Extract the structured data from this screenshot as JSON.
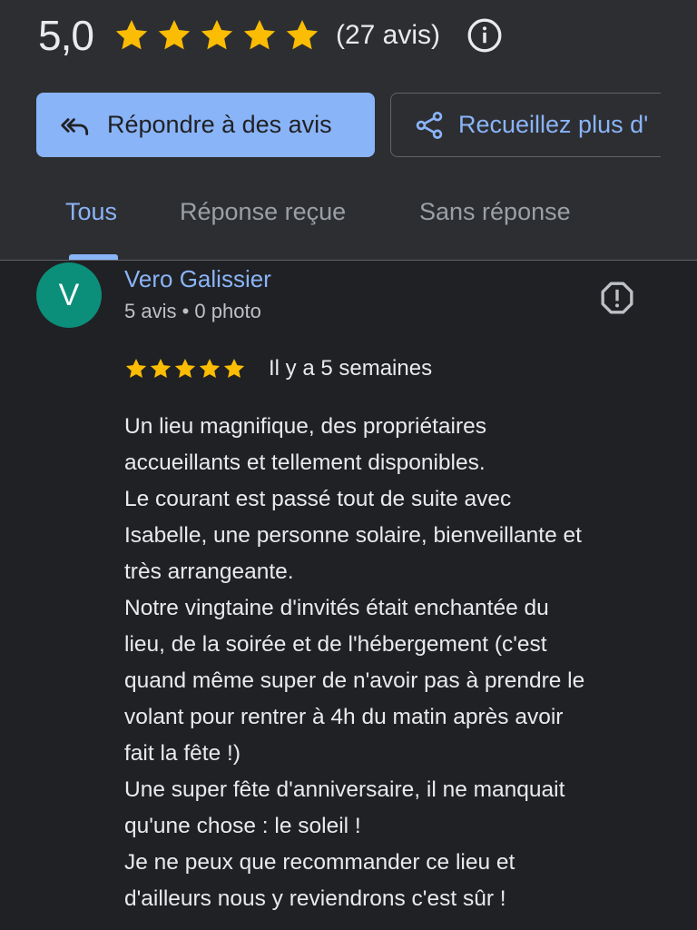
{
  "summary": {
    "score": "5,0",
    "star_count": 5,
    "star_color": "#fbbc04",
    "review_count": "(27 avis)",
    "info_icon": "info-icon"
  },
  "actions": {
    "reply_label": "Répondre à des avis",
    "reply_icon": "reply-all-icon",
    "collect_label": "Recueillez plus d'",
    "collect_icon": "share-icon"
  },
  "tabs": [
    {
      "label": "Tous",
      "active": true
    },
    {
      "label": "Réponse reçue",
      "active": false
    },
    {
      "label": "Sans réponse",
      "active": false
    }
  ],
  "review": {
    "avatar_letter": "V",
    "avatar_color": "#0b8e7a",
    "author": "Vero Galissier",
    "meta": "5 avis • 0 photo",
    "rating": 5,
    "date": "Il y a 5 semaines",
    "report_icon": "report-icon",
    "text_lines": [
      "Un lieu magnifique, des propriétaires",
      "accueillants et tellement disponibles.",
      "Le courant est passé tout de suite avec",
      "Isabelle, une personne solaire, bienveillante et",
      "très arrangeante.",
      "Notre vingtaine d'invités était enchantée du",
      "lieu, de la soirée et de l'hébergement (c'est",
      "quand même super de n'avoir pas à prendre le",
      "volant pour rentrer à 4h du matin après avoir",
      "fait la fête !)",
      "Une super fête d'anniversaire, il ne manquait",
      "qu'une chose : le soleil !",
      "Je ne peux que recommander ce lieu et",
      "d'ailleurs nous y reviendrons c'est sûr !"
    ]
  },
  "colors": {
    "accent": "#8ab4f8",
    "header_bg": "#2d2e31",
    "body_bg": "#202124"
  }
}
